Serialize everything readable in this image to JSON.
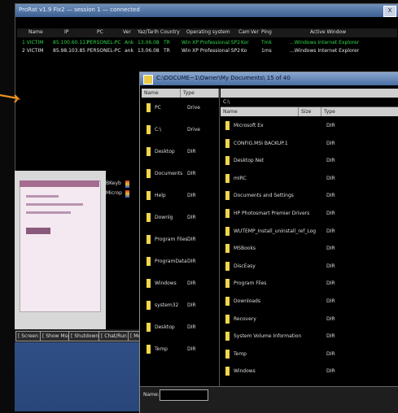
{
  "back_window": {
    "title": "ProRat v1.9 Fix2 — session 1 — connected",
    "close_label": "X",
    "columns": [
      "Name",
      "IP",
      "PC",
      "Ver",
      "Yaz/Tarih",
      "Country",
      "Operating system",
      "Cam",
      "Ver",
      "Ping",
      "Active Window"
    ],
    "sessions": [
      {
        "name": "1 VICTIM",
        "ip": "85.100.60.117",
        "pc": "PERSONEL-PC",
        "ver": "Ank",
        "date": "13.06.08",
        "country": "TR",
        "os": "Win XP Professional SP2",
        "cam": "Kor",
        "ping": "Tmk",
        "window": "...Windows Internet Explorer"
      },
      {
        "name": "2 VICTIM",
        "ip": "85.98.103.85",
        "pc": "PERSONEL-PC",
        "ver": "ank",
        "date": "13.06.08",
        "country": "TR",
        "os": "Win XP Professional SP2",
        "cam": "Ko",
        "ping": "1ms",
        "window": "...Windows Internet Explorer"
      }
    ],
    "side_info": [
      "BKeyb",
      "Microp"
    ],
    "tabs": [
      "[ Screen ]",
      "[ Show Msg ]",
      "[ Shutdown ]",
      "[ Chat/Run ]",
      "[ Mess"
    ]
  },
  "file_dialog": {
    "title": "C:\\DOCUME~1\\Owner\\My Documents\\ 15 of 40",
    "left_headers": [
      "Name",
      "Type"
    ],
    "left_items": [
      {
        "name": "PC",
        "type": "Drive"
      },
      {
        "name": "C:\\",
        "type": "Drive"
      },
      {
        "name": "Desktop",
        "type": "DIR"
      },
      {
        "name": "Documents",
        "type": "DIR"
      },
      {
        "name": "Help",
        "type": "DIR"
      },
      {
        "name": "Downlg",
        "type": "DIR"
      },
      {
        "name": "Program Files",
        "type": "DIR"
      },
      {
        "name": "ProgramData",
        "type": "DIR"
      },
      {
        "name": "Windows",
        "type": "DIR"
      },
      {
        "name": "system32",
        "type": "DIR"
      },
      {
        "name": "Desktop",
        "type": "DIR"
      },
      {
        "name": "Temp",
        "type": "DIR"
      }
    ],
    "path": "C:\\",
    "right_headers": [
      "Name",
      "Size",
      "Type"
    ],
    "right_items": [
      {
        "name": "Microsoft Ex",
        "type": "DIR"
      },
      {
        "name": "CONFIG.MSI BACKUP.1",
        "type": "DIR"
      },
      {
        "name": "Desktop Net",
        "type": "DIR"
      },
      {
        "name": "mIRC",
        "type": "DIR"
      },
      {
        "name": "Documents and Settings",
        "type": "DIR"
      },
      {
        "name": "HP Photosmart Premier Drivers",
        "type": "DIR"
      },
      {
        "name": "WUTEMP_Install_uninstall_ref_Log",
        "type": "DIR"
      },
      {
        "name": "MSBooks",
        "type": "DIR"
      },
      {
        "name": "DiscEasy",
        "type": "DIR"
      },
      {
        "name": "Program Files",
        "type": "DIR"
      },
      {
        "name": "Downloads",
        "type": "DIR"
      },
      {
        "name": "Recovery",
        "type": "DIR"
      },
      {
        "name": "System Volume Information",
        "type": "DIR"
      },
      {
        "name": "Temp",
        "type": "DIR"
      },
      {
        "name": "Windows",
        "type": "DIR"
      }
    ],
    "name_label": "Name:"
  },
  "colors": {
    "session_text": "#2fd64a",
    "folder": "#f0d64a",
    "arrow": "#e8901e",
    "desktop": "#2f4f86"
  }
}
